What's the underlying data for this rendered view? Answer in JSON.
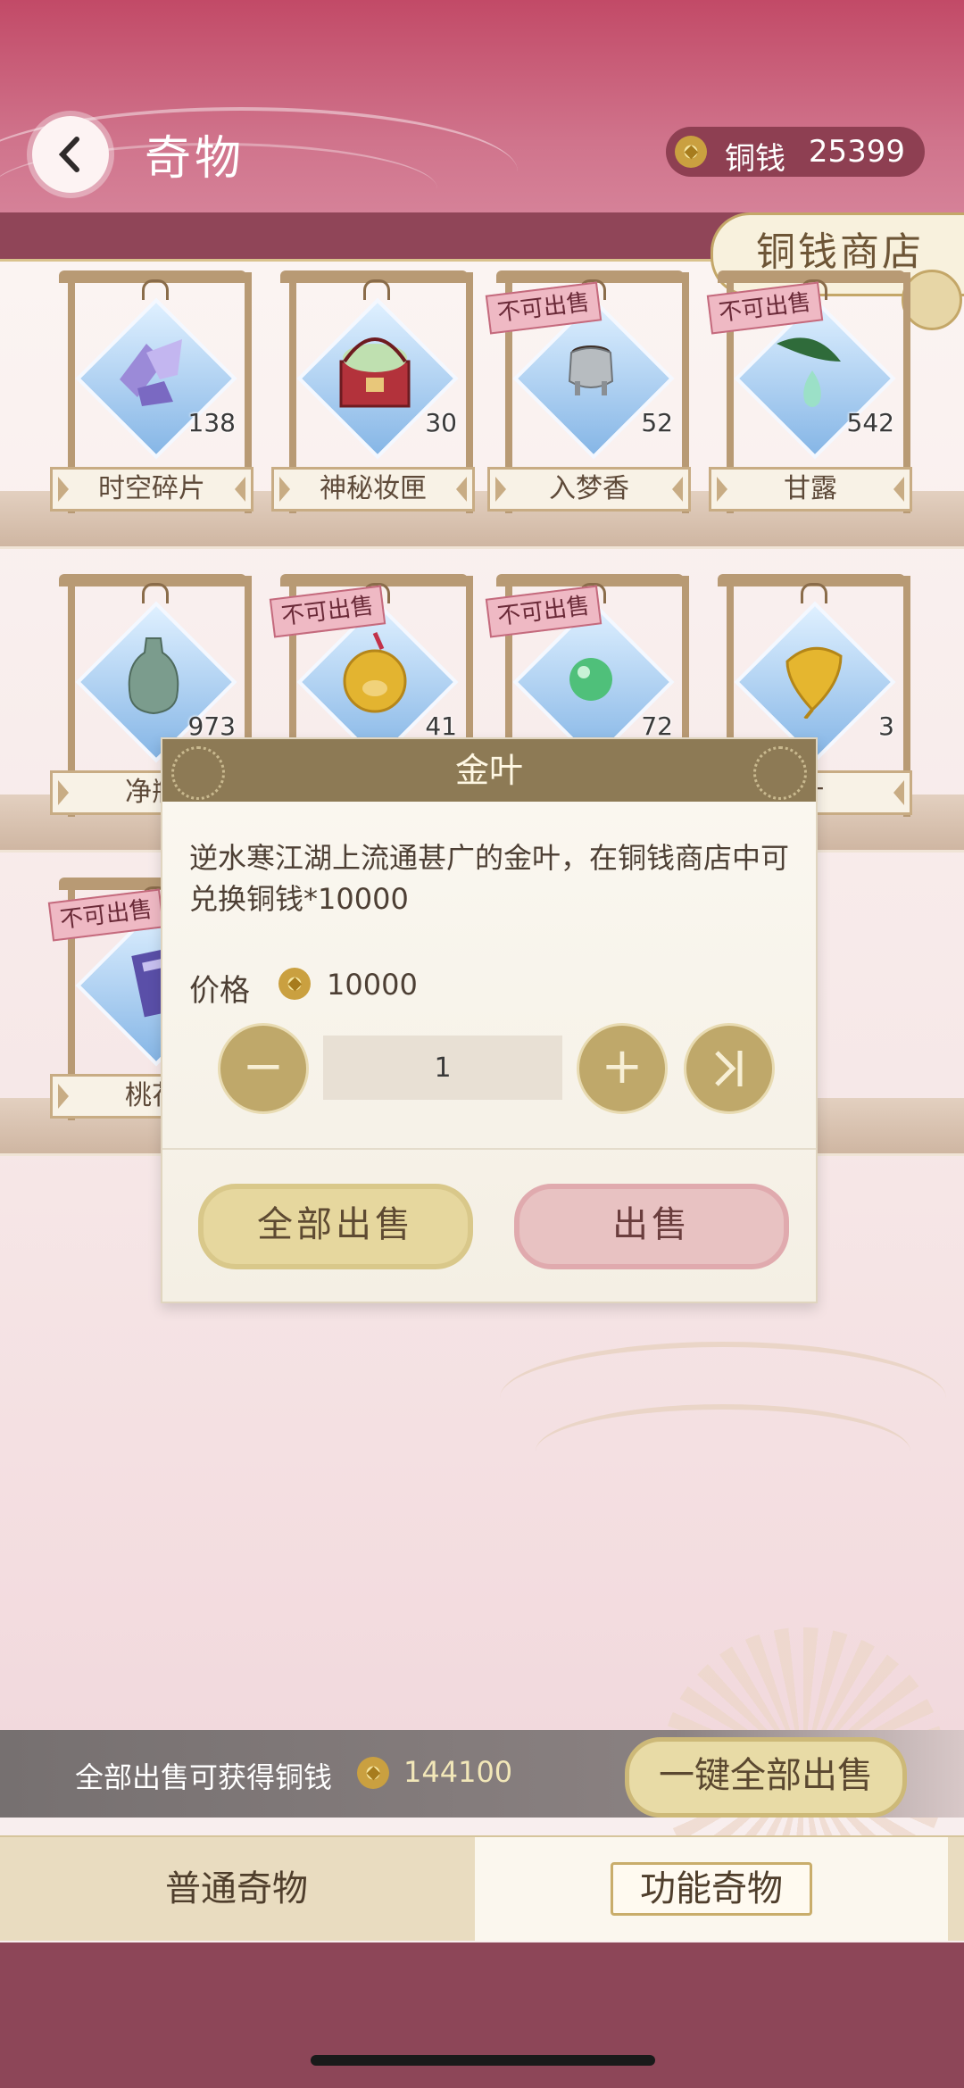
{
  "header": {
    "title": "奇物",
    "coin_label": "铜钱",
    "coin_value": "25399",
    "shop_button": "铜钱商店"
  },
  "items": [
    {
      "name": "时空碎片",
      "count": "138",
      "tag": ""
    },
    {
      "name": "神秘妆匣",
      "count": "30",
      "tag": ""
    },
    {
      "name": "入梦香",
      "count": "52",
      "tag": "不可出售"
    },
    {
      "name": "甘露",
      "count": "542",
      "tag": "不可出售"
    },
    {
      "name": "净瓶",
      "count": "973",
      "tag": ""
    },
    {
      "name": "",
      "count": "41",
      "tag": "不可出售"
    },
    {
      "name": "",
      "count": "72",
      "tag": "不可出售"
    },
    {
      "name": "叶",
      "count": "3",
      "tag": ""
    },
    {
      "name": "桃花",
      "count": "",
      "tag": "不可出售"
    }
  ],
  "modal": {
    "title": "金叶",
    "description": "逆水寒江湖上流通甚广的金叶，在铜钱商店中可兑换铜钱*10000",
    "price_label": "价格",
    "price_value": "10000",
    "minus": "−",
    "plus": "+",
    "quantity": "1",
    "sell_all_button": "全部出售",
    "sell_button": "出售"
  },
  "sell_bar": {
    "text": "全部出售可获得铜钱",
    "value": "144100",
    "button": "一键全部出售"
  },
  "tabs": [
    {
      "label": "普通奇物",
      "active": false
    },
    {
      "label": "功能奇物",
      "active": true
    }
  ]
}
